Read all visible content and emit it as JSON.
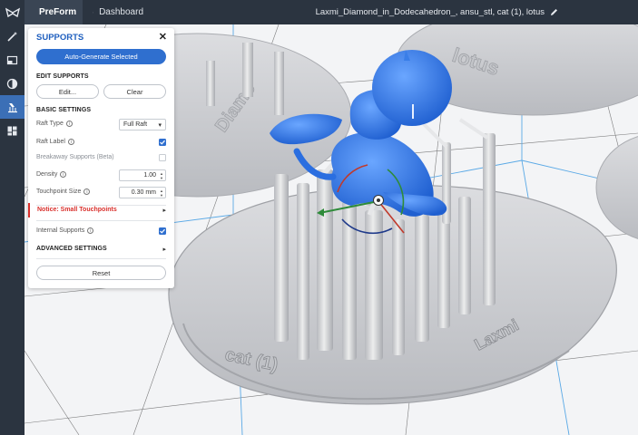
{
  "topbar": {
    "tabs": [
      {
        "label": "PreForm",
        "active": true
      },
      {
        "label": "Dashboard",
        "active": false
      }
    ],
    "filename": "Laxmi_Diamond_in_Dodecahedron_, ansu_stl, cat (1), lotus"
  },
  "colors": {
    "accent": "#2f6fcf",
    "notice": "#d9302c",
    "chrome": "#2b3440"
  },
  "rail": [
    "magic-wand-icon",
    "orientation-icon",
    "layout-icon",
    "supports-icon",
    "layout-grid-icon"
  ],
  "panel": {
    "title": "SUPPORTS",
    "auto_generate": "Auto-Generate Selected",
    "edit_section": "EDIT SUPPORTS",
    "edit_button": "Edit...",
    "clear_button": "Clear",
    "basic_section": "BASIC SETTINGS",
    "raft_type_label": "Raft Type",
    "raft_type_value": "Full Raft",
    "raft_label_label": "Raft Label",
    "raft_label_checked": true,
    "breakaway_label": "Breakaway Supports (Beta)",
    "breakaway_checked": false,
    "density_label": "Density",
    "density_value": "1.00",
    "touchpoint_label": "Touchpoint Size",
    "touchpoint_value": "0.30 mm",
    "notice": "Notice: Small Touchpoints",
    "internal_label": "Internal Supports",
    "internal_checked": true,
    "advanced_section": "ADVANCED SETTINGS",
    "reset_button": "Reset"
  },
  "scene": {
    "rafts": [
      {
        "label": "cat (1)"
      },
      {
        "label": "lotus"
      },
      {
        "label": "Diamo"
      },
      {
        "label": "Laxmi"
      }
    ]
  }
}
